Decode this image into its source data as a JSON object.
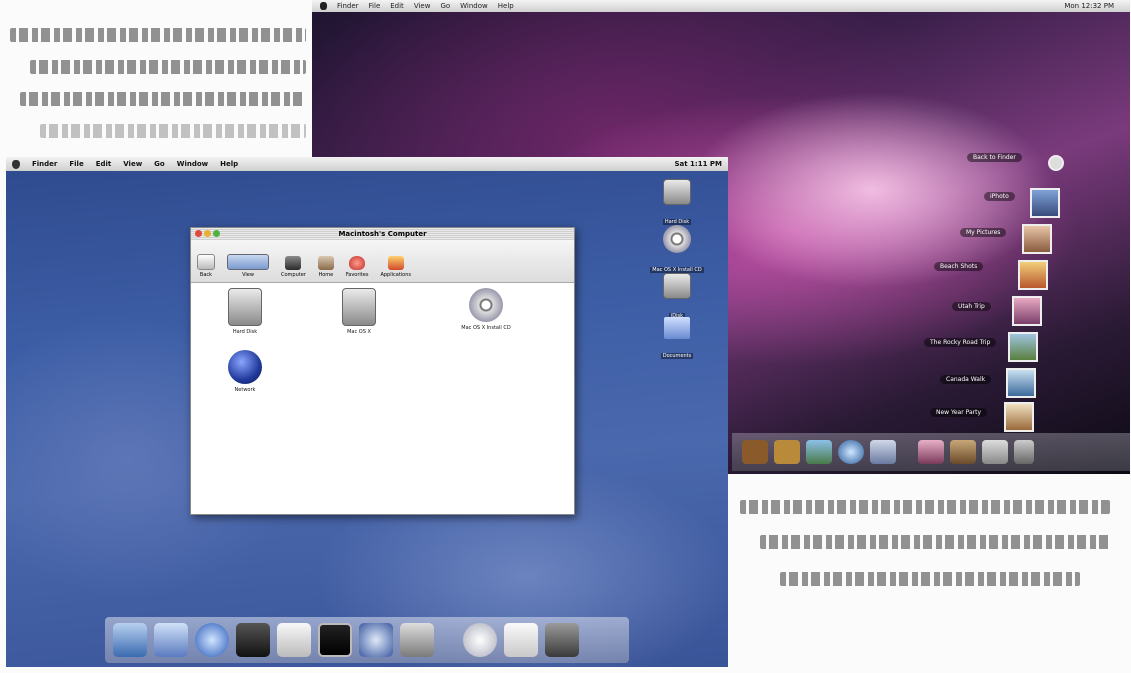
{
  "leopard": {
    "menubar": {
      "items": [
        "Finder",
        "File",
        "Edit",
        "View",
        "Go",
        "Window",
        "Help"
      ],
      "clock": "Mon 12:32 PM"
    },
    "stack_labels": [
      "Back to Finder",
      "iPhoto",
      "My Pictures",
      "Beach Shots",
      "Utah Trip",
      "The Rocky Road Trip",
      "Canada Walk",
      "New Year Party"
    ]
  },
  "classic": {
    "menubar": {
      "items": [
        "Finder",
        "File",
        "Edit",
        "View",
        "Go",
        "Window",
        "Help"
      ],
      "clock": "Sat 1:11 PM"
    },
    "desktop_icons": [
      {
        "label": "Hard Disk",
        "icon": "hard-drive-icon"
      },
      {
        "label": "Mac OS X Install CD",
        "icon": "cd-icon"
      },
      {
        "label": "iDisk",
        "icon": "hard-drive-icon"
      },
      {
        "label": "Documents",
        "icon": "folder-icon"
      }
    ],
    "window": {
      "title": "Macintosh's Computer",
      "toolbar": [
        {
          "label": "Back",
          "icon": "back-arrow-icon"
        },
        {
          "label": "View",
          "icon": "view-icon"
        },
        {
          "label": "Computer",
          "icon": "computer-icon"
        },
        {
          "label": "Home",
          "icon": "home-icon"
        },
        {
          "label": "Favorites",
          "icon": "heart-icon"
        },
        {
          "label": "Applications",
          "icon": "applications-icon"
        }
      ],
      "items": [
        {
          "label": "Hard Disk",
          "icon": "hard-drive-icon"
        },
        {
          "label": "Mac OS X",
          "icon": "hard-drive-icon"
        },
        {
          "label": "Mac OS X Install CD",
          "icon": "cd-icon"
        },
        {
          "label": "Network",
          "icon": "network-globe-icon"
        }
      ]
    },
    "dock_icons": [
      "finder-icon",
      "mail-icon",
      "internet-explorer-icon",
      "sherlock-icon",
      "itunes-icon",
      "monitor-icon",
      "quicktime-icon",
      "system-preferences-icon",
      "mail-at-icon",
      "documents-icon",
      "trash-icon"
    ]
  },
  "colors": {
    "classic_desktop": "#3d5ea6",
    "leopard_accent": "#b44c9c",
    "menubar": "#e6e6e6"
  }
}
